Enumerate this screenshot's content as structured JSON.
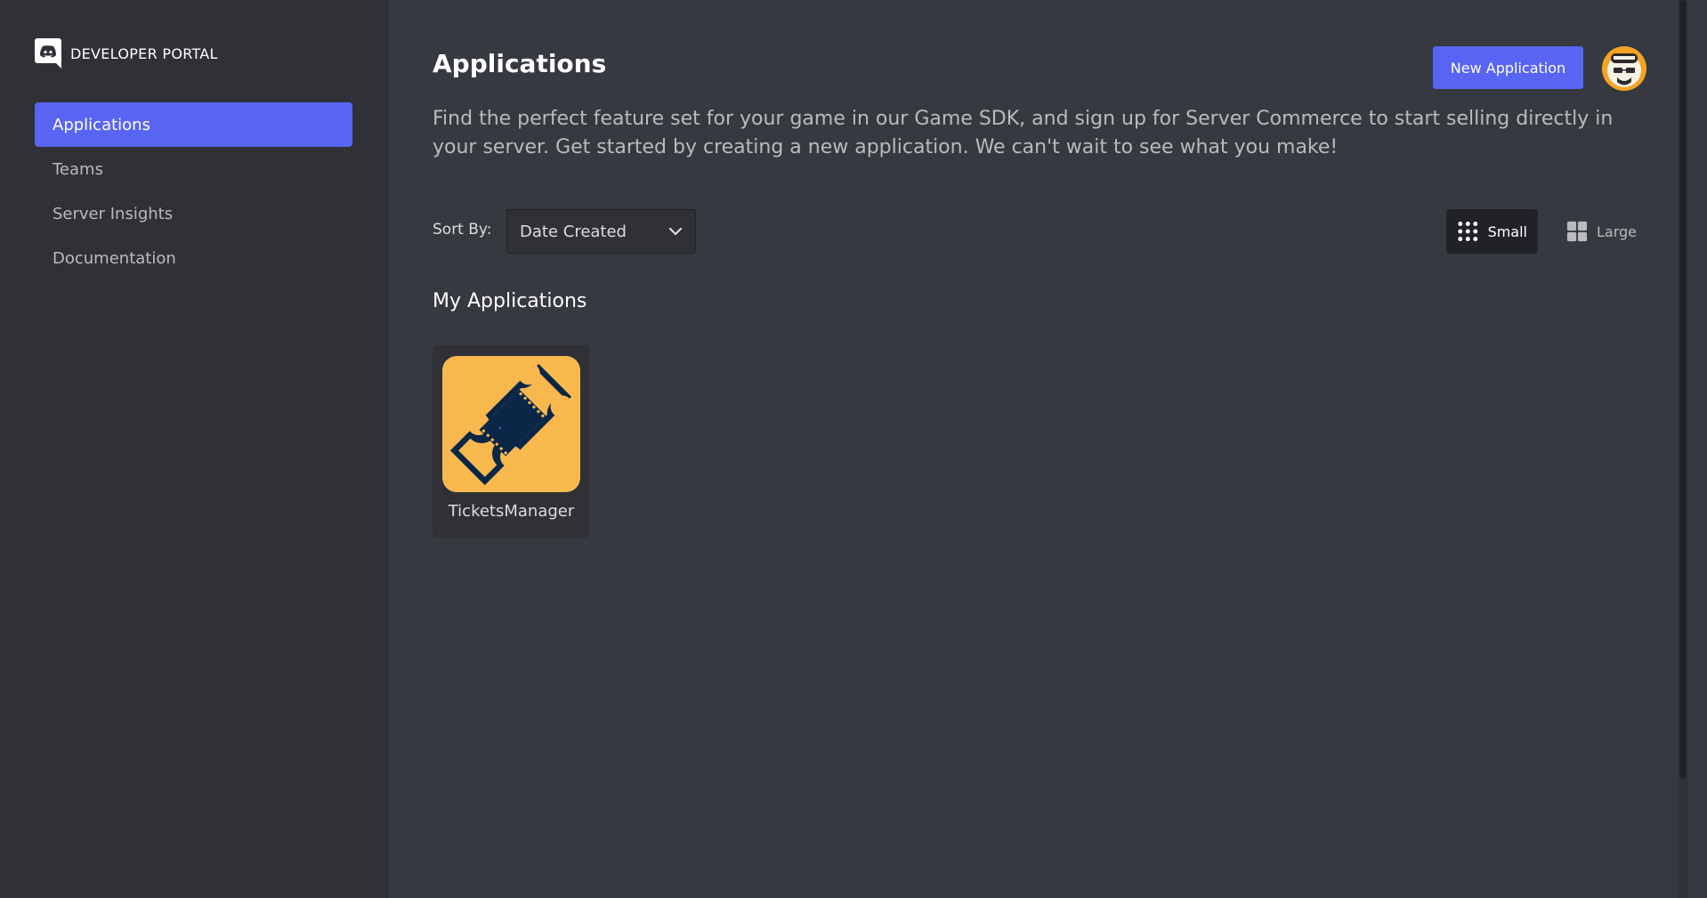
{
  "brand": {
    "title": "DEVELOPER PORTAL",
    "logo_icon": "discord-logo-icon"
  },
  "sidebar": {
    "items": [
      {
        "label": "Applications",
        "active": true
      },
      {
        "label": "Teams",
        "active": false
      },
      {
        "label": "Server Insights",
        "active": false
      },
      {
        "label": "Documentation",
        "active": false
      }
    ]
  },
  "header": {
    "title": "Applications",
    "new_app_label": "New Application",
    "avatar_icon": "user-avatar"
  },
  "description": "Find the perfect feature set for your game in our Game SDK, and sign up for Server Commerce to start selling directly in your server. Get started by creating a new application. We can't wait to see what you make!",
  "sort": {
    "label": "Sort By:",
    "selected": "Date Created"
  },
  "view": {
    "small_label": "Small",
    "large_label": "Large",
    "selected": "Small"
  },
  "my_apps": {
    "title": "My Applications",
    "items": [
      {
        "name": "TicketsManager",
        "icon": "ticket-icon"
      }
    ]
  },
  "colors": {
    "accent": "#5865f2",
    "sidebar_bg": "#2f3136",
    "main_bg": "#36393f",
    "app_icon_bg": "#f8b84e"
  }
}
